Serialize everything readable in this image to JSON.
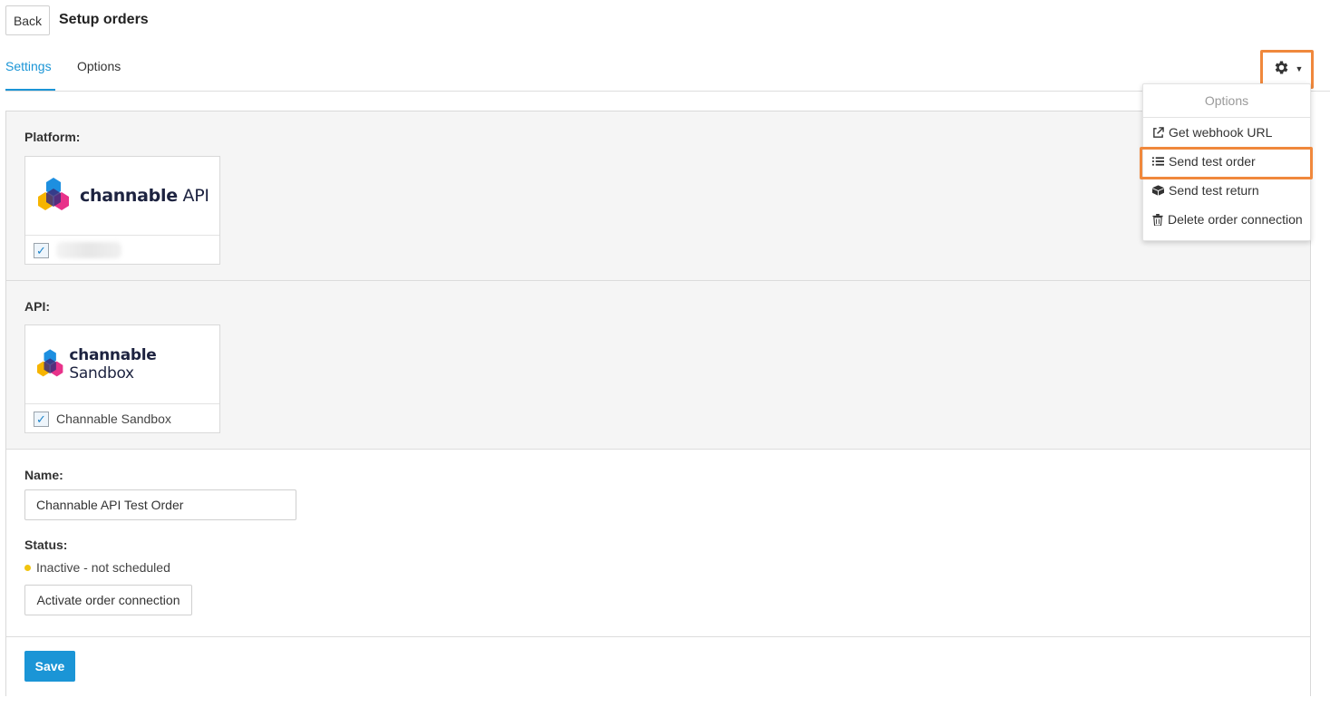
{
  "header": {
    "back_label": "Back",
    "title": "Setup orders"
  },
  "tabs": [
    {
      "label": "Settings",
      "active": true
    },
    {
      "label": "Options",
      "active": false
    }
  ],
  "gear_menu": {
    "header": "Options",
    "items": [
      {
        "label": "Get webhook URL",
        "icon": "external-link-icon"
      },
      {
        "label": "Send test order",
        "icon": "list-icon",
        "highlighted": true
      },
      {
        "label": "Send test return",
        "icon": "box-icon"
      },
      {
        "label": "Delete order connection",
        "icon": "trash-icon"
      }
    ]
  },
  "platform": {
    "label": "Platform:",
    "logo_brand": "channable",
    "logo_suffix": "API",
    "checked": true
  },
  "api": {
    "label": "API:",
    "logo_brand": "channable",
    "logo_suffix": "Sandbox",
    "checked": true,
    "caption": "Channable Sandbox"
  },
  "name": {
    "label": "Name:",
    "value": "Channable API Test Order"
  },
  "status": {
    "label": "Status:",
    "text": "Inactive - not scheduled",
    "dot_color": "#f1c40f",
    "activate_label": "Activate order connection"
  },
  "footer": {
    "save_label": "Save"
  },
  "colors": {
    "accent": "#1b95d6",
    "highlight": "#f0883c"
  }
}
